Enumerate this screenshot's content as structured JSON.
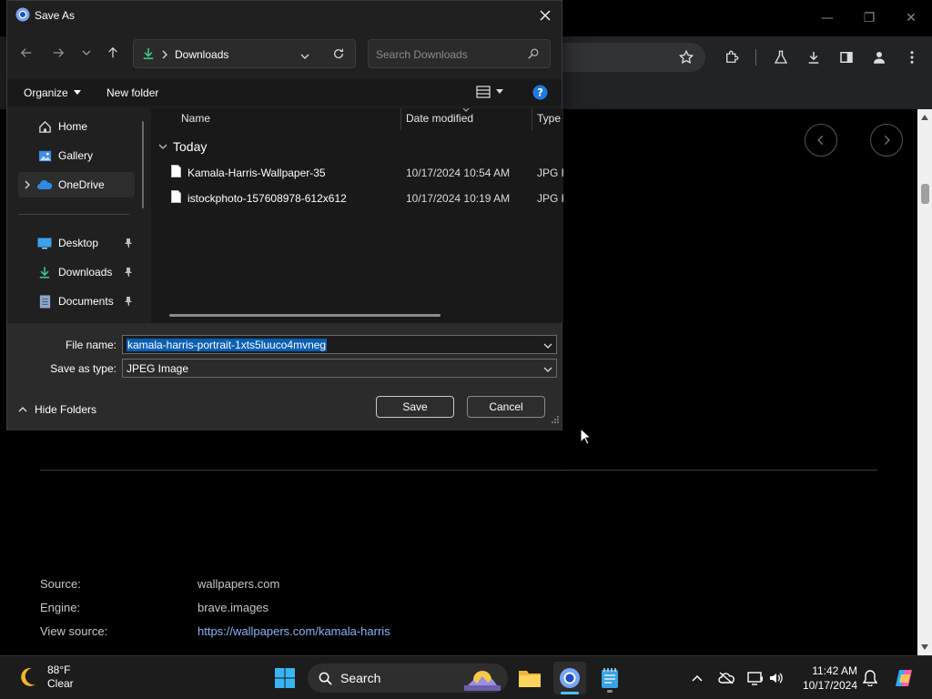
{
  "dialog": {
    "title": "Save As",
    "address": {
      "location": "Downloads"
    },
    "search": {
      "placeholder": "Search Downloads"
    },
    "commands": {
      "organize": "Organize",
      "new_folder": "New folder"
    },
    "nav": {
      "items": [
        {
          "label": "Home",
          "icon": "home-icon"
        },
        {
          "label": "Gallery",
          "icon": "gallery-icon"
        },
        {
          "label": "OneDrive",
          "icon": "onedrive-icon",
          "selected": true
        },
        {
          "label": "Desktop",
          "icon": "desktop-icon",
          "pinned": true
        },
        {
          "label": "Downloads",
          "icon": "downloads-icon",
          "pinned": true
        },
        {
          "label": "Documents",
          "icon": "documents-icon",
          "pinned": true
        }
      ]
    },
    "files": {
      "columns": {
        "name": "Name",
        "date": "Date modified",
        "type": "Type"
      },
      "group": "Today",
      "rows": [
        {
          "name": "Kamala-Harris-Wallpaper-35",
          "date": "10/17/2024 10:54 AM",
          "type": "JPG F"
        },
        {
          "name": "istockphoto-157608978-612x612",
          "date": "10/17/2024 10:19 AM",
          "type": "JPG F"
        }
      ]
    },
    "filename": {
      "label": "File name:",
      "value": "kamala-harris-portrait-1xts5luuco4mvneg"
    },
    "filetype": {
      "label": "Save as type:",
      "value": "JPEG Image"
    },
    "hide_folders": "Hide Folders",
    "save": "Save",
    "cancel": "Cancel"
  },
  "page": {
    "meta": [
      {
        "label": "Source:",
        "value": "wallpapers.com",
        "link": false
      },
      {
        "label": "Engine:",
        "value": "brave.images",
        "link": false
      },
      {
        "label": "View source:",
        "value": "https://wallpapers.com/kamala-harris",
        "link": true
      }
    ]
  },
  "taskbar": {
    "weather": {
      "temp": "88°F",
      "condition": "Clear"
    },
    "search": "Search",
    "clock": {
      "time": "11:42 AM",
      "date": "10/17/2024"
    }
  },
  "colors": {
    "accent": "#0a5fb4",
    "link": "#8ab4f8",
    "indicator": "#4cc2ff"
  }
}
